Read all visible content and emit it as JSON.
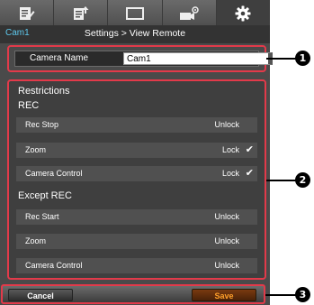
{
  "tabs": [
    {
      "icon": "document-edit-icon"
    },
    {
      "icon": "document-upload-icon"
    },
    {
      "icon": "monitor-icon"
    },
    {
      "icon": "camera-settings-icon"
    },
    {
      "icon": "gear-icon",
      "active": true
    }
  ],
  "header": {
    "camera_id": "Cam1",
    "title": "Settings > View Remote"
  },
  "camera_name": {
    "label": "Camera Name",
    "value": "Cam1"
  },
  "restrictions": {
    "title": "Restrictions",
    "rec_title": "REC",
    "rec_items": [
      {
        "label": "Rec Stop",
        "value": "Unlock",
        "checked": false
      },
      {
        "label": "Zoom",
        "value": "Lock",
        "checked": true
      },
      {
        "label": "Camera Control",
        "value": "Lock",
        "checked": true
      }
    ],
    "except_title": "Except REC",
    "except_items": [
      {
        "label": "Rec Start",
        "value": "Unlock"
      },
      {
        "label": "Zoom",
        "value": "Unlock"
      },
      {
        "label": "Camera Control",
        "value": "Unlock"
      }
    ]
  },
  "footer": {
    "cancel_label": "Cancel",
    "save_label": "Save"
  },
  "callouts": [
    "1",
    "2",
    "3"
  ],
  "colors": {
    "highlight": "#e23a4a",
    "cam_id": "#5ec9ee",
    "save_text": "#ff9f2a"
  }
}
